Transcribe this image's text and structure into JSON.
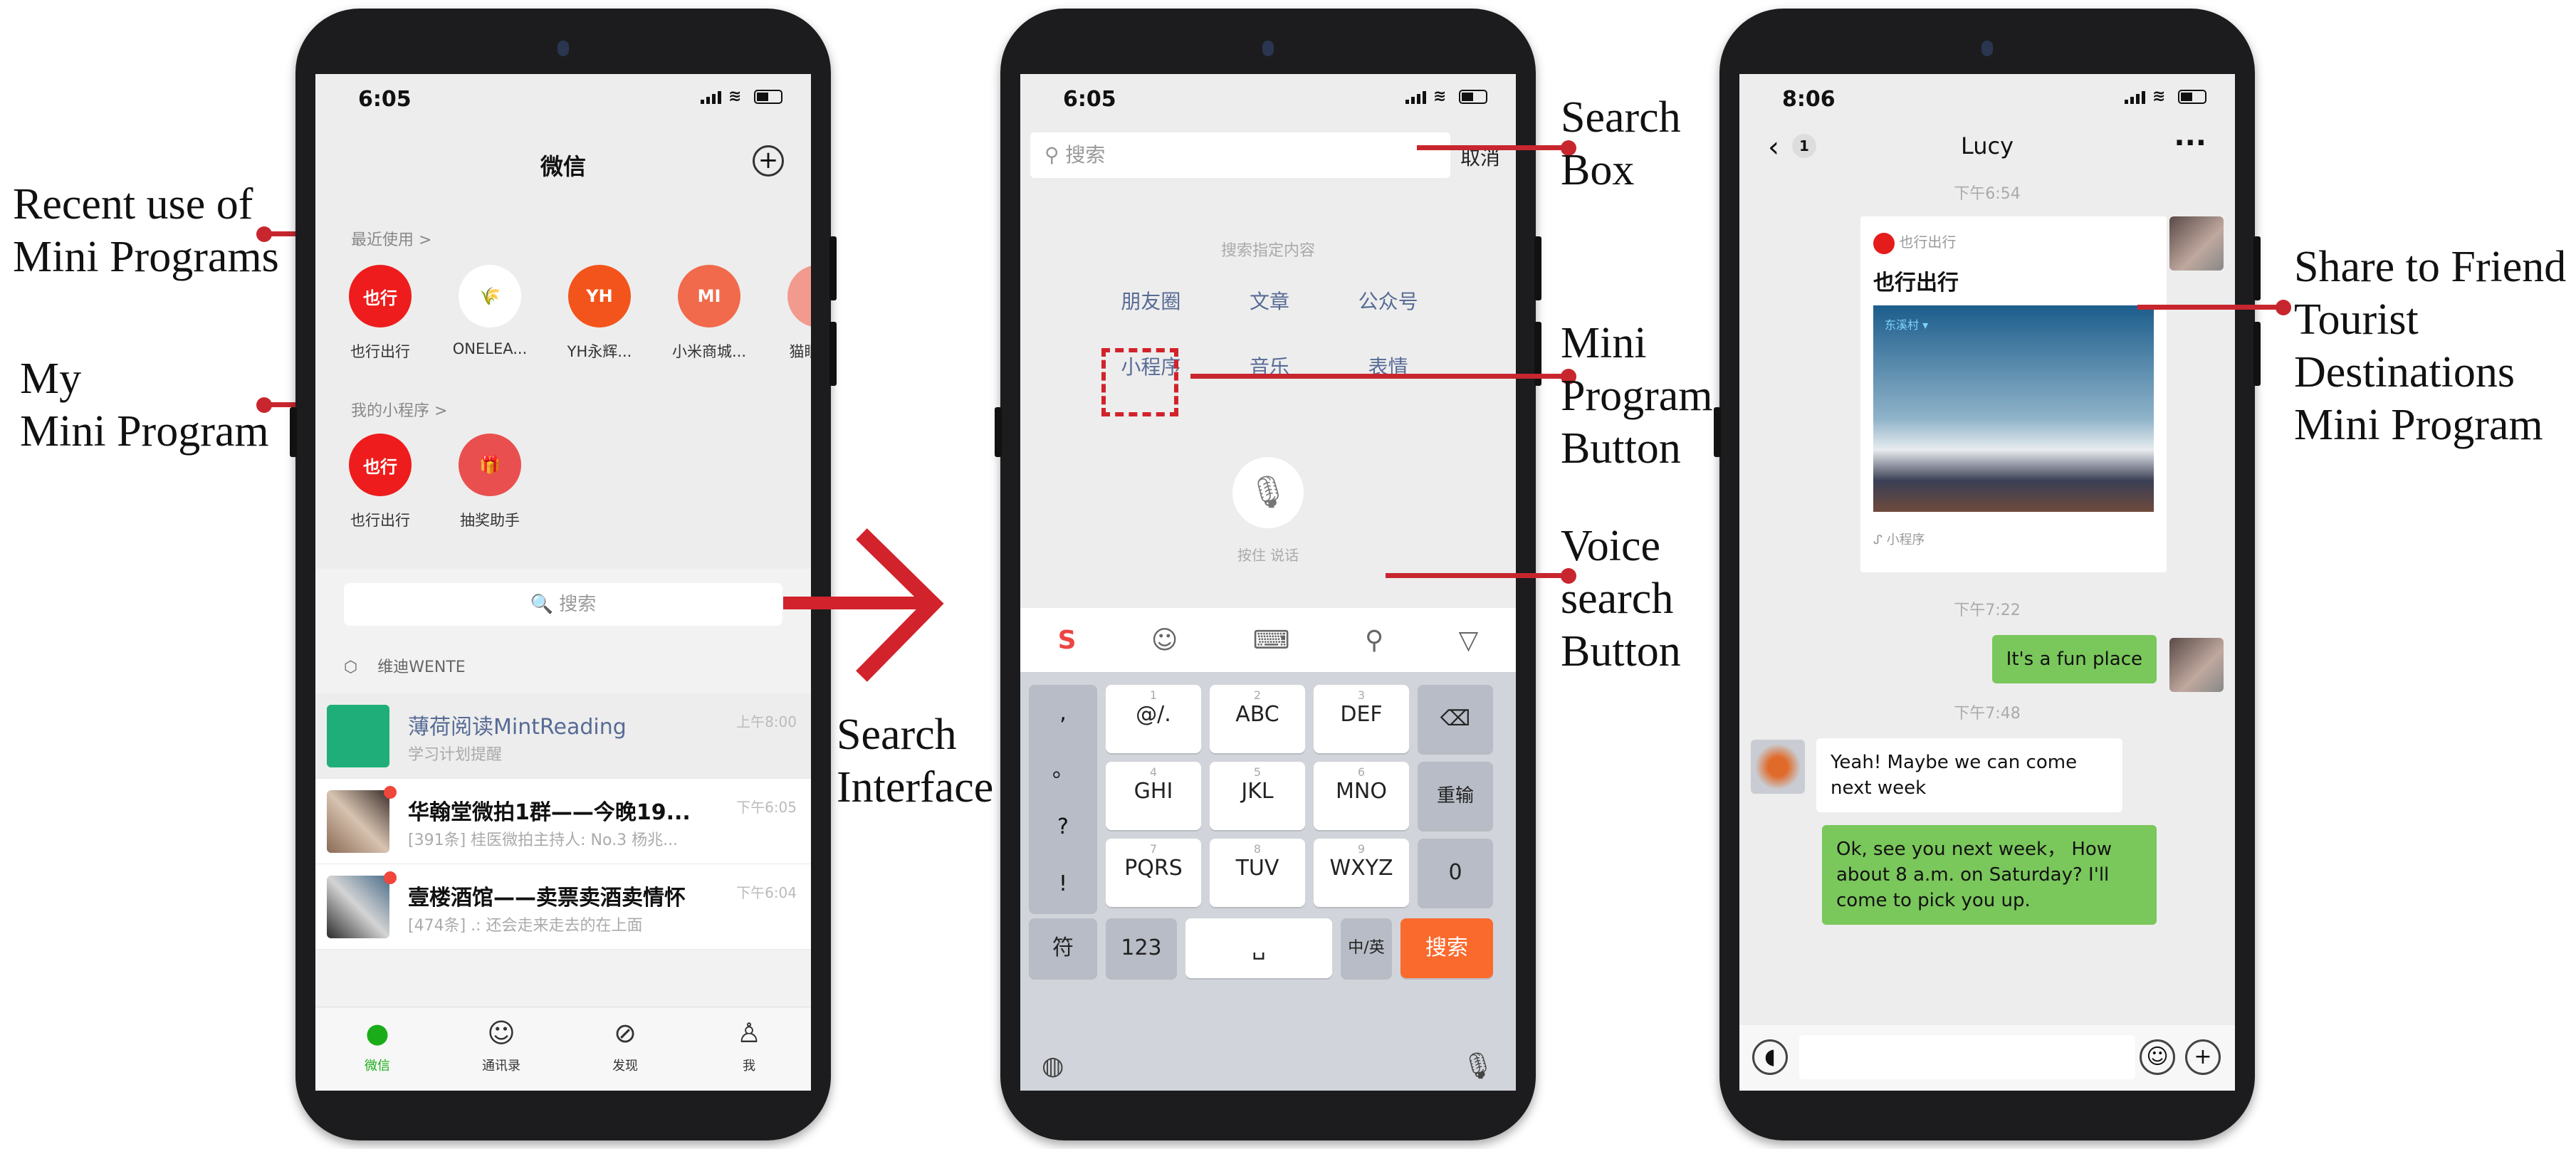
{
  "annotations": {
    "recent_use": [
      "Recent use of",
      "Mini Programs"
    ],
    "my_mini": [
      "My",
      "Mini Program"
    ],
    "search_interface": [
      "Search",
      "Interface"
    ],
    "search_box": [
      "Search",
      "Box"
    ],
    "mini_program_button": [
      "Mini",
      "Program",
      "Button"
    ],
    "voice_search_button": [
      "Voice",
      "search",
      "Button"
    ],
    "share": [
      "Share to Friend",
      "Tourist",
      "Destinations",
      "Mini Program"
    ]
  },
  "accent_color": "#c8262e",
  "phone1": {
    "time": "6:05",
    "title": "微信",
    "recent_label": "最近使用 >",
    "recent_apps": [
      {
        "label": "也行出行",
        "icon": "也行",
        "color": "#ee1c1c"
      },
      {
        "label": "ONELEA...",
        "icon": "🌾",
        "color": "#ffffff"
      },
      {
        "label": "YH永辉...",
        "icon": "YH",
        "color": "#f3541b"
      },
      {
        "label": "小米商城...",
        "icon": "MI",
        "color": "#f16a4c"
      },
      {
        "label": "猫眼电...",
        "icon": "Q",
        "color": "#f29a8e"
      }
    ],
    "my_label": "我的小程序 >",
    "my_apps": [
      {
        "label": "也行出行",
        "icon": "也行",
        "color": "#ee1c1c"
      },
      {
        "label": "抽奖助手",
        "icon": "🎁",
        "color": "#ea4f4f"
      }
    ],
    "search_placeholder": "🔍 搜索",
    "folder_label": "维迪WENTE",
    "chats": [
      {
        "name": "薄荷阅读MintReading",
        "preview": "学习计划提醒",
        "time": "上午8:00",
        "badge": false
      },
      {
        "name": "华翰堂微拍1群——今晚19...",
        "preview": "[391条] 桂医微拍主持人: No.3  杨兆...",
        "time": "下午6:05",
        "badge": true
      },
      {
        "name": "壹楼酒馆——卖票卖酒卖情怀",
        "preview": "[474条] .: 还会走来走去的在上面",
        "time": "下午6:04",
        "badge": true
      }
    ],
    "tabs": [
      "微信",
      "通讯录",
      "发现",
      "我"
    ]
  },
  "phone2": {
    "time": "6:05",
    "search_placeholder": "搜索",
    "cancel": "取消",
    "hint": "搜索指定内容",
    "categories": [
      "朋友圈",
      "文章",
      "公众号",
      "小程序",
      "音乐",
      "表情"
    ],
    "voice_label": "按住 说话",
    "keyboard": {
      "side": [
        ",",
        "。",
        "?",
        "!"
      ],
      "keys": [
        {
          "num": "1",
          "label": "@/."
        },
        {
          "num": "2",
          "label": "ABC"
        },
        {
          "num": "3",
          "label": "DEF"
        },
        {
          "num": "4",
          "label": "GHI"
        },
        {
          "num": "5",
          "label": "JKL"
        },
        {
          "num": "6",
          "label": "MNO"
        },
        {
          "num": "7",
          "label": "PQRS"
        },
        {
          "num": "8",
          "label": "TUV"
        },
        {
          "num": "9",
          "label": "WXYZ"
        }
      ],
      "backspace": "⌫",
      "reenter": "重输",
      "zero": "0",
      "symbols": "符",
      "num": "123",
      "space": "␣",
      "lang": "中/英",
      "search": "搜索"
    }
  },
  "phone3": {
    "time": "8:06",
    "contact": "Lucy",
    "unread": "1",
    "ts1": "下午6:54",
    "card_source": "也行出行",
    "card_title": "也行出行",
    "card_image_caption": "东溪村 ▾",
    "card_footer": "小程序",
    "ts2": "下午7:22",
    "msg1": "It's a fun place",
    "ts3": "下午7:48",
    "msg2": "Yeah! Maybe we can come next week",
    "msg3": "Ok, see you next week， How about 8 a.m. on Saturday?  I'll come to pick you up."
  }
}
